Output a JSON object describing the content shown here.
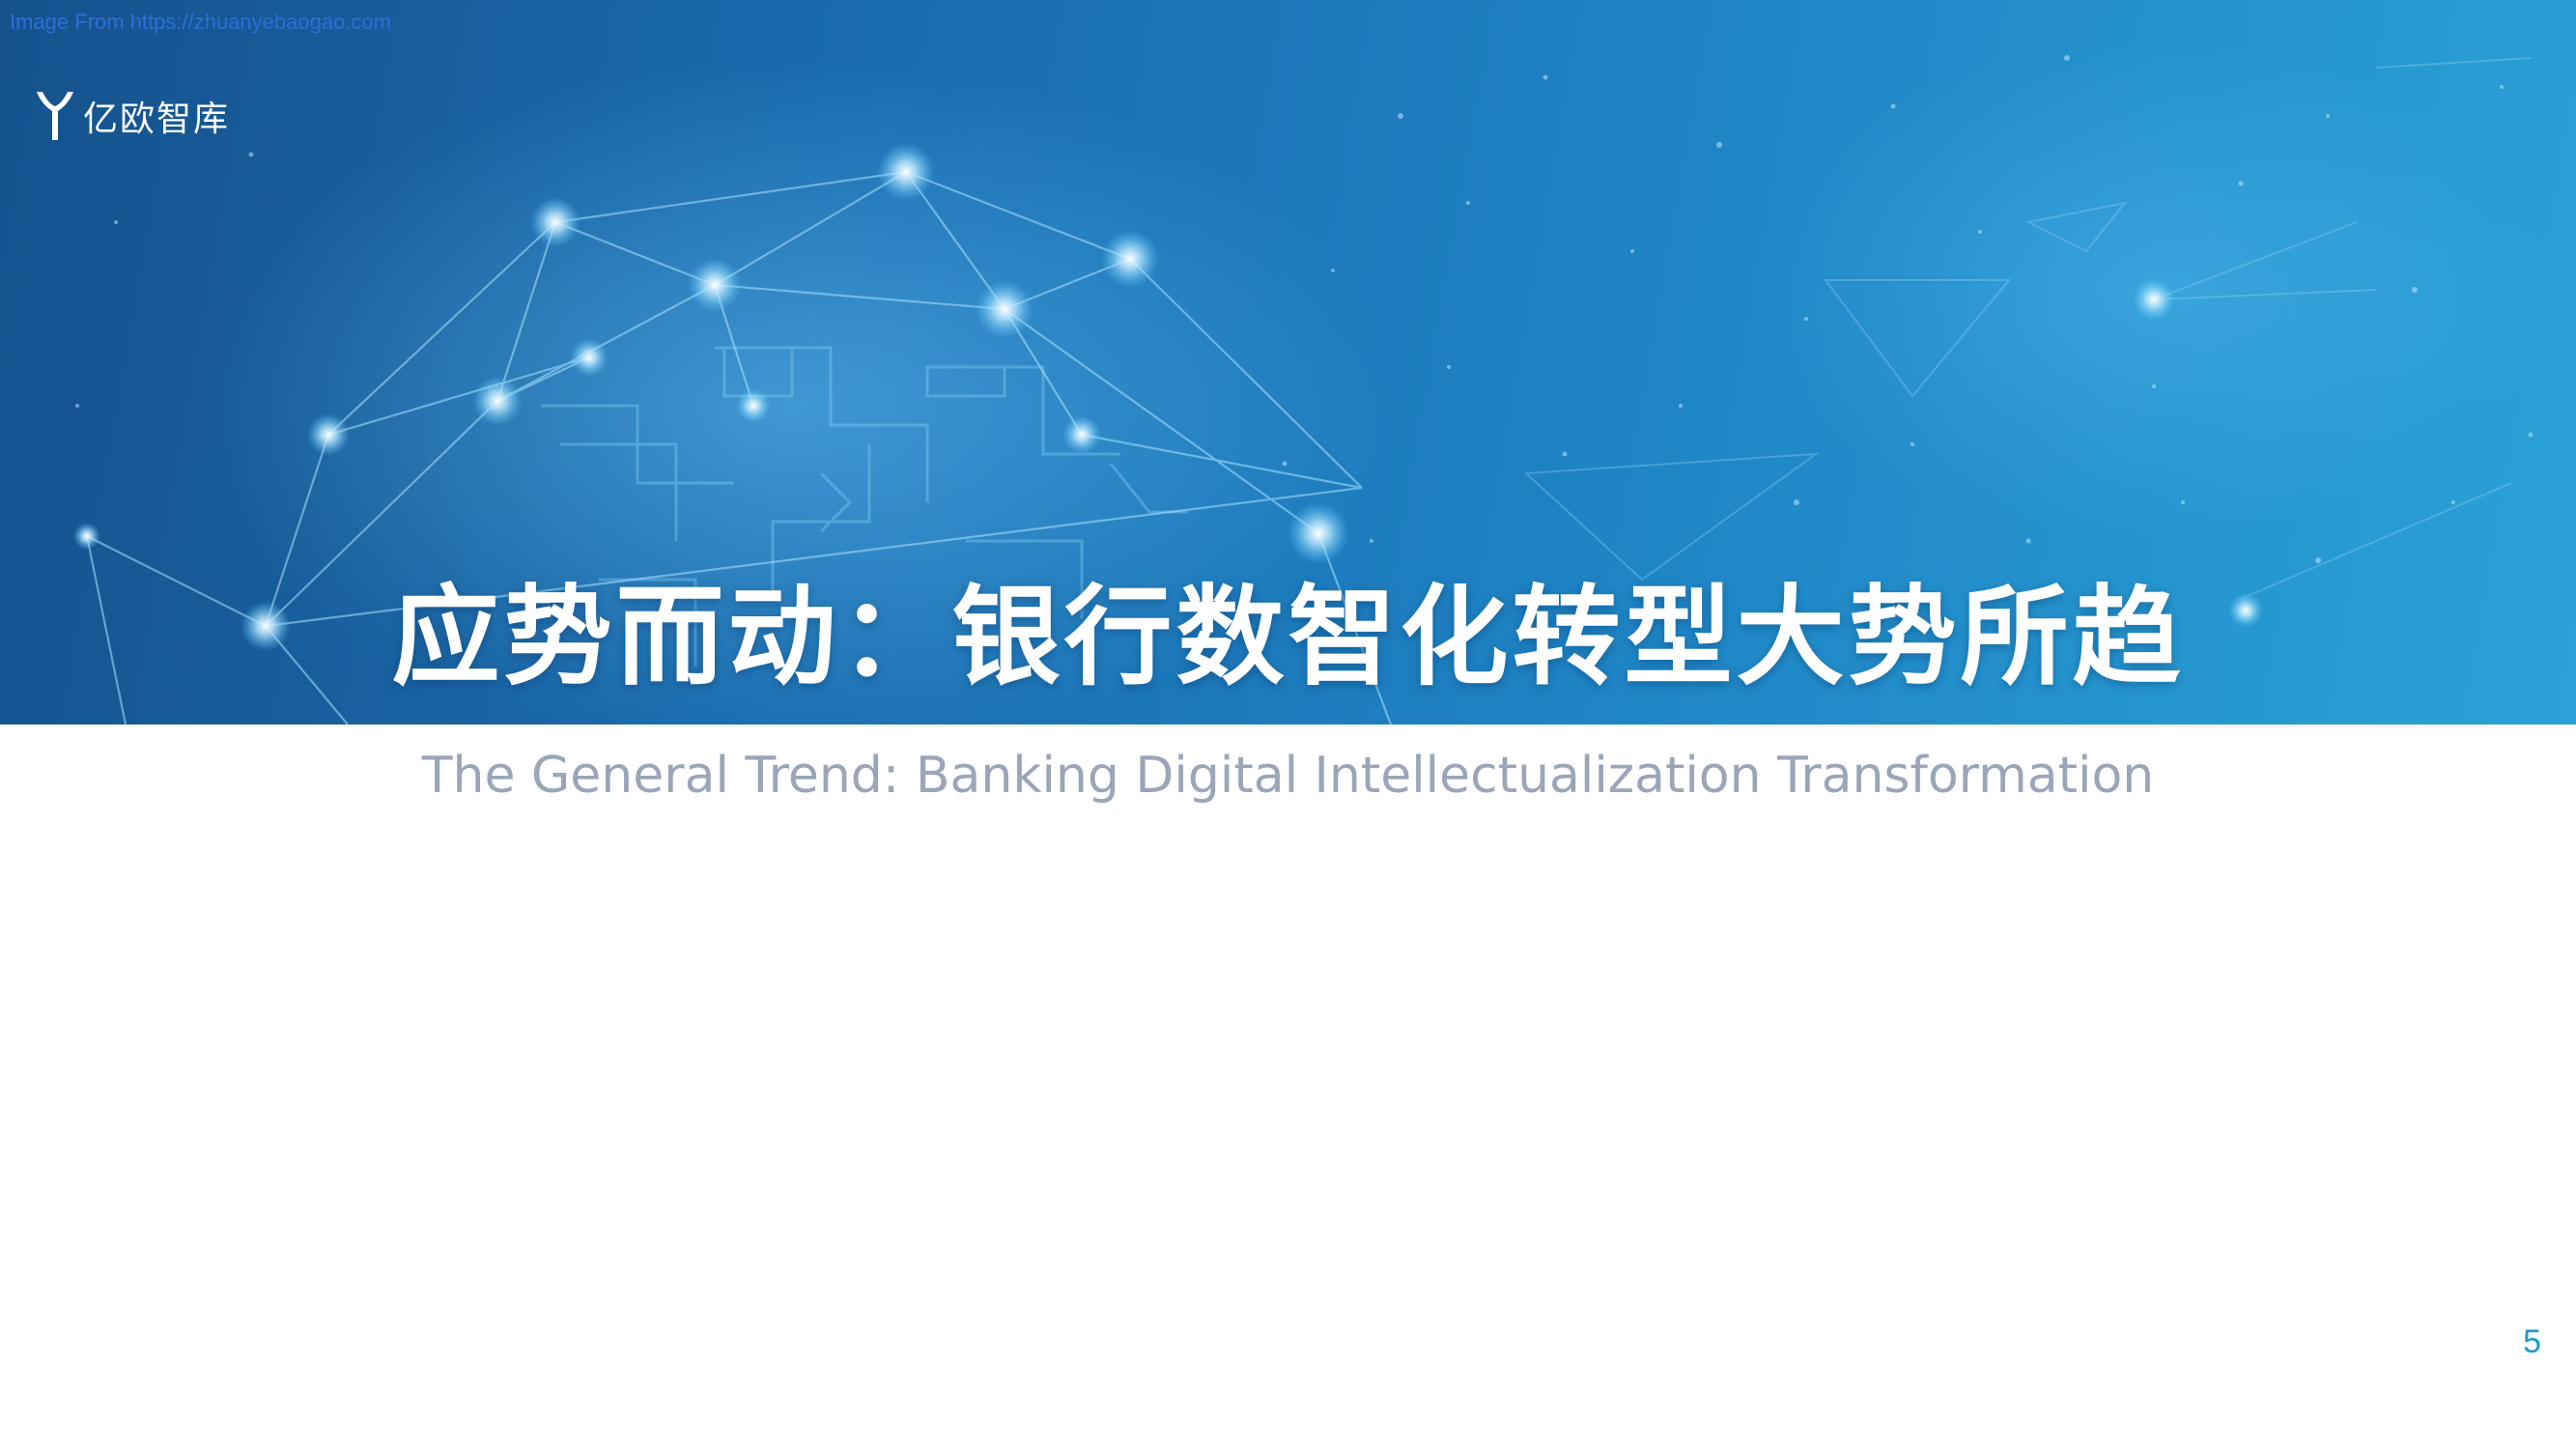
{
  "source_note": "Image From https://zhuanyebaogao.com",
  "logo": {
    "icon": "yiou-y-logo-icon",
    "text": "亿欧智库"
  },
  "title": "应势而动：银行数智化转型大势所趋",
  "subtitle": "The General Trend: Banking Digital Intellectualization Transformation",
  "page_number": "5",
  "colors": {
    "banner_dark": "#15528c",
    "banner_light": "#2aa2d6",
    "title": "#ffffff",
    "subtitle": "#9aa5b8",
    "page_number": "#1c9bc4",
    "source_note": "#2a6fd6"
  }
}
